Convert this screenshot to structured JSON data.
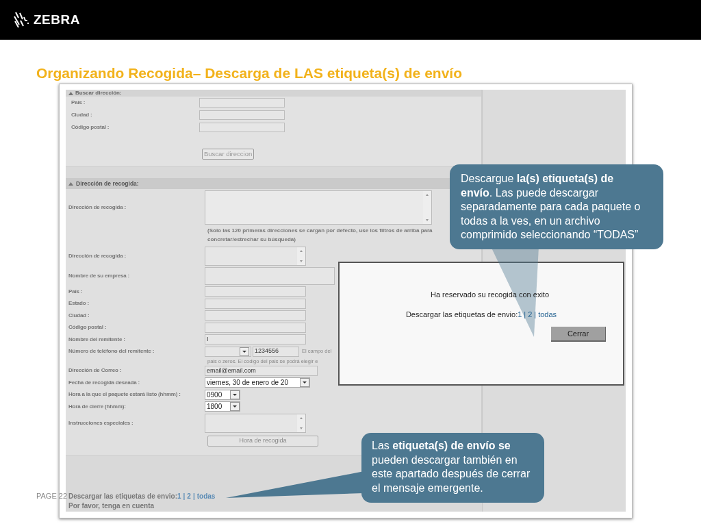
{
  "header": {
    "logo": "ZEBRA"
  },
  "title": "Organizando Recogida– Descarga de LAS etiqueta(s) de envío",
  "screenshot": {
    "search_section": {
      "title": "Buscar dirección:",
      "rows": [
        {
          "kind": "input",
          "label": "País :"
        },
        {
          "kind": "input",
          "label": "Ciudad :"
        },
        {
          "kind": "input",
          "label": "Código postal :"
        }
      ],
      "button": "Buscar direccion"
    },
    "pickup_section": {
      "title": "Dirección de recogida:",
      "rows": [
        {
          "kind": "listbox",
          "label": "Dirección de recogida :"
        },
        {
          "kind": "note",
          "text": "(Solo las 120 primeras direcciones se cargan por defecto, use los filtros de arriba para concretar/estrechar su búsqueda)"
        },
        {
          "kind": "textarea",
          "label": "Dirección de recogida :"
        },
        {
          "kind": "tall_input",
          "label": "Nombre de su empresa :"
        },
        {
          "kind": "input",
          "label": "País :"
        },
        {
          "kind": "input",
          "label": "Estado :"
        },
        {
          "kind": "input",
          "label": "Ciudad :"
        },
        {
          "kind": "input",
          "label": "Código postal :"
        },
        {
          "kind": "input",
          "label": "Nombre del remitente :",
          "value": "I"
        },
        {
          "kind": "phone",
          "label": "Número de teléfono del remitente :",
          "value": "1234556",
          "note": "El campo del",
          "note_2": "pais o zeros. El codigo del pais se podrá elegir e"
        },
        {
          "kind": "wide_input",
          "label": "Dirección de Correo :",
          "value": "email@email.com"
        },
        {
          "kind": "date_select",
          "label": "Fecha de recogida deseada :",
          "value": "viernes, 30 de enero de 20"
        },
        {
          "kind": "time_select",
          "label": "Hora a la que el paquete estará listo (hhmm) :",
          "value": "0900"
        },
        {
          "kind": "time_select",
          "label": "Hora de cierre (hhmm):",
          "value": "1800"
        },
        {
          "kind": "textarea",
          "label": "Instrucciones especiales :"
        },
        {
          "kind": "button",
          "text": "Hora de recogida"
        }
      ]
    },
    "download": {
      "label": "Descargar las etiquetas de envio:",
      "links": [
        "1",
        "2",
        "todas"
      ],
      "separator": "|"
    },
    "footer_note": "Por favor, tenga en cuenta",
    "modal": {
      "message": "Ha reservado su recogida con exito",
      "download_label": "Descargar las etiquetas de envio:",
      "links": [
        "1",
        "2",
        "todas"
      ],
      "separator": "|",
      "button": "Cerrar"
    }
  },
  "callouts": [
    {
      "text": "Descargue **la(s) etiqueta(s) de envío**. Las puede descargar separadamente para cada paquete o todas a la ves, en un archivo comprimido seleccionando “TODAS”"
    },
    {
      "text": "Las **etiqueta(s) de envío se** pueden descargar también en este apartado después de cerrar el mensaje emergente."
    }
  ],
  "page_number": "PAGE 22"
}
